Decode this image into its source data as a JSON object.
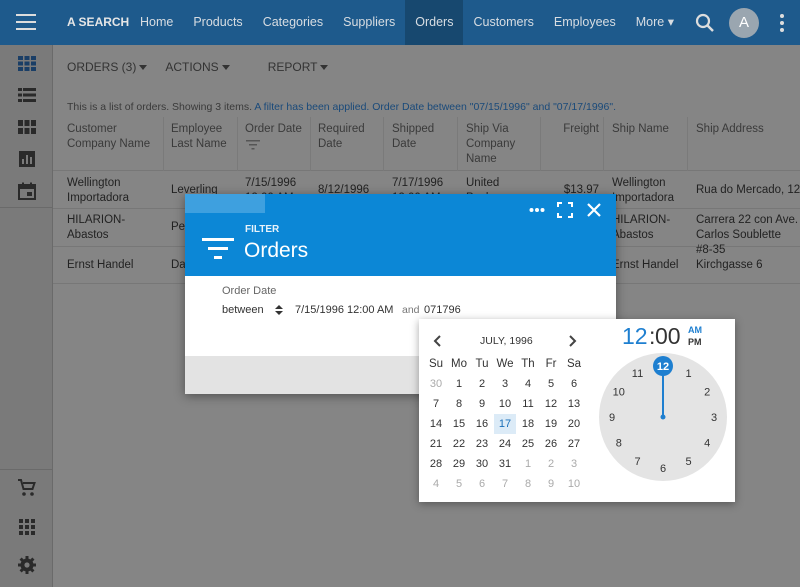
{
  "app": {
    "brand": "A SEARCH"
  },
  "nav": [
    "Home",
    "Products",
    "Categories",
    "Suppliers",
    "Orders",
    "Customers",
    "Employees",
    "More ▾"
  ],
  "user": {
    "avatar_letter": "A"
  },
  "toolbar": {
    "orders": "ORDERS (3)",
    "actions": "ACTIONS",
    "report": "REPORT"
  },
  "info": {
    "text": "This is a list of orders. Showing 3 items. ",
    "filter": "A filter has been applied. Order Date between \"07/15/1996\" and \"07/17/1996\"."
  },
  "grid": {
    "headers": [
      "Customer Company Name",
      "Employee Last Name",
      "Order Date",
      "Required Date",
      "Shipped Date",
      "Ship Via Company Name",
      "Freight",
      "Ship Name",
      "Ship Address"
    ],
    "rows": [
      [
        "Wellington Importadora",
        "Leverling",
        "7/15/1996 12:00 AM",
        "8/12/1996",
        "7/17/1996 12:00 AM",
        "United Package",
        "$13.97",
        "Wellington Importadora",
        "Rua do Mercado, 12"
      ],
      [
        "HILARION-Abastos",
        "Peacock",
        "",
        "",
        "",
        "",
        "",
        "HILARION-Abastos",
        "Carrera 22 con Ave. Carlos Soublette #8-35"
      ],
      [
        "Ernst Handel",
        "Davolio",
        "",
        "",
        "",
        "",
        "",
        "Ernst Handel",
        "Kirchgasse 6"
      ]
    ]
  },
  "dialog": {
    "kind": "FILTER",
    "title": "Orders",
    "field_label": "Order Date",
    "operator": "between",
    "value1": "7/15/1996 12:00 AM",
    "conj": "and",
    "value2": "071796"
  },
  "picker": {
    "month": "JULY, 1996",
    "dow": [
      "Su",
      "Mo",
      "Tu",
      "We",
      "Th",
      "Fr",
      "Sa"
    ],
    "weeks": [
      [
        "30",
        "1",
        "2",
        "3",
        "4",
        "5",
        "6"
      ],
      [
        "7",
        "8",
        "9",
        "10",
        "11",
        "12",
        "13"
      ],
      [
        "14",
        "15",
        "16",
        "17",
        "18",
        "19",
        "20"
      ],
      [
        "21",
        "22",
        "23",
        "24",
        "25",
        "26",
        "27"
      ],
      [
        "28",
        "29",
        "30",
        "31",
        "1",
        "2",
        "3"
      ],
      [
        "4",
        "5",
        "6",
        "7",
        "8",
        "9",
        "10"
      ]
    ],
    "selected_day": "17",
    "hour": "12",
    "minute": "00",
    "am": "AM",
    "pm": "PM",
    "clock_numbers": [
      "12",
      "1",
      "2",
      "3",
      "4",
      "5",
      "6",
      "7",
      "8",
      "9",
      "10",
      "11"
    ]
  },
  "colors": {
    "topbar": "#1e5a8c",
    "dialog_head": "#0c87d6",
    "accent": "#1e7fd0"
  }
}
